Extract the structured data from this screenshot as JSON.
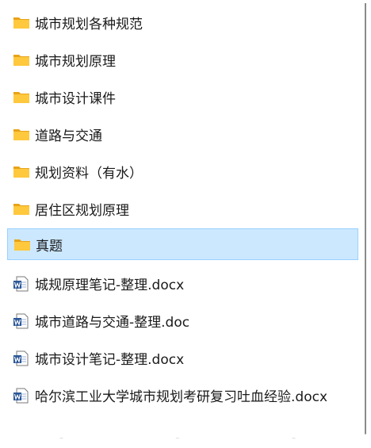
{
  "items": [
    {
      "label": "城市规划各种规范",
      "type": "folder",
      "selected": false
    },
    {
      "label": "城市规划原理",
      "type": "folder",
      "selected": false
    },
    {
      "label": "城市设计课件",
      "type": "folder",
      "selected": false
    },
    {
      "label": "道路与交通",
      "type": "folder",
      "selected": false
    },
    {
      "label": "规划资料（有水）",
      "type": "folder",
      "selected": false
    },
    {
      "label": "居住区规划原理",
      "type": "folder",
      "selected": false
    },
    {
      "label": "真题",
      "type": "folder",
      "selected": true
    },
    {
      "label": "城规原理笔记-整理.docx",
      "type": "word-document",
      "selected": false
    },
    {
      "label": "城市道路与交通-整理.doc",
      "type": "word-document",
      "selected": false
    },
    {
      "label": "城市设计笔记-整理.docx",
      "type": "word-document",
      "selected": false
    },
    {
      "label": "哈尔滨工业大学城市规划考研复习吐血经验.docx",
      "type": "word-document",
      "selected": false
    }
  ],
  "icons": {
    "folder": "folder-icon",
    "word-document": "word-document-icon"
  },
  "colors": {
    "selection_background": "#cce8ff",
    "selection_border": "#99d1ff",
    "folder": "#ffc83d",
    "word_blue": "#2b5797"
  }
}
